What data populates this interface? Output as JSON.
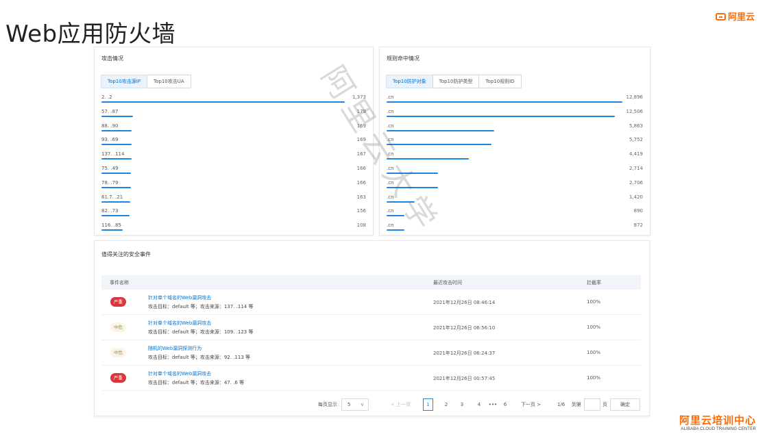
{
  "slide": {
    "title": "Web应用防火墙"
  },
  "brand": {
    "logo_text": "阿里云",
    "training_cn": "阿里云培训中心",
    "training_en": "ALIBABA CLOUD TRAINING CENTER"
  },
  "watermark": {
    "text": "阿里云大学"
  },
  "attack_panel": {
    "title": "攻击情况",
    "tabs": [
      {
        "label": "Top10攻击源IP",
        "active": true
      },
      {
        "label": "Top10攻击UA",
        "active": false
      }
    ],
    "rows": [
      {
        "label": "2.  .2",
        "value": "1,373",
        "pct": 0.92
      },
      {
        "label": "57.    .87",
        "value": "179",
        "pct": 0.12
      },
      {
        "label": "88.    .90",
        "value": "169",
        "pct": 0.115
      },
      {
        "label": "93.    .69",
        "value": "169",
        "pct": 0.115
      },
      {
        "label": "137.      .114",
        "value": "167",
        "pct": 0.113
      },
      {
        "label": "75.    .49",
        "value": "166",
        "pct": 0.112
      },
      {
        "label": "78.    .79",
        "value": "166",
        "pct": 0.112
      },
      {
        "label": "61.7.  .21",
        "value": "163",
        "pct": 0.11
      },
      {
        "label": "82.    .73",
        "value": "156",
        "pct": 0.106
      },
      {
        "label": "116.    .85",
        "value": "108",
        "pct": 0.08
      }
    ]
  },
  "rule_panel": {
    "title": "规则命中情况",
    "tabs": [
      {
        "label": "Top10防护对象",
        "active": true
      },
      {
        "label": "Top10防护类型",
        "active": false
      },
      {
        "label": "Top10规则ID",
        "active": false
      }
    ],
    "rows": [
      {
        "label": ".cn",
        "value": "12,896",
        "pct": 0.92
      },
      {
        "label": ".cn",
        "value": "12,506",
        "pct": 0.89
      },
      {
        "label": ".cn",
        "value": "5,863",
        "pct": 0.42
      },
      {
        "label": ".cn",
        "value": "5,752",
        "pct": 0.41
      },
      {
        "label": ".cn",
        "value": "4,419",
        "pct": 0.32
      },
      {
        "label": ".cn",
        "value": "2,714",
        "pct": 0.2
      },
      {
        "label": ".cn",
        "value": "2,706",
        "pct": 0.2
      },
      {
        "label": ".cn",
        "value": "1,420",
        "pct": 0.11
      },
      {
        "label": ".cn",
        "value": "890",
        "pct": 0.07
      },
      {
        "label": ".cn",
        "value": "872",
        "pct": 0.07
      }
    ]
  },
  "events_panel": {
    "title": "值得关注的安全事件",
    "columns": {
      "name": "事件名称",
      "time": "最近攻击时间",
      "rate": "拦截率"
    },
    "rows": [
      {
        "severity": "严重",
        "level": "high",
        "name": "针对单个域名的Web漏洞攻击",
        "desc": "攻击目标：default 等；攻击来源：137.        .114 等",
        "time": "2021年12月26日 08:46:14",
        "rate": "100%"
      },
      {
        "severity": "中危",
        "level": "mid",
        "name": "针对单个域名的Web漏洞攻击",
        "desc": "攻击目标：default 等；攻击来源：109.        .123 等",
        "time": "2021年12月26日 06:56:10",
        "rate": "100%"
      },
      {
        "severity": "中危",
        "level": "mid",
        "name": "随机的Web漏洞探测行为",
        "desc": "攻击目标：default 等；攻击来源：92.        .113 等",
        "time": "2021年12月26日 06:24:37",
        "rate": "100%"
      },
      {
        "severity": "严重",
        "level": "high",
        "name": "针对单个域名的Web漏洞攻击",
        "desc": "攻击目标：default 等；攻击来源：47.        .6 等",
        "time": "2021年12月26日 00:57:45",
        "rate": "100%"
      }
    ],
    "pagination": {
      "page_size_label": "每页显示",
      "page_size": "5",
      "prev": "< 上一页",
      "pages": [
        "1",
        "2",
        "3",
        "4"
      ],
      "ellipsis": "•••",
      "last_page": "6",
      "next": "下一页 >",
      "current": "1/6",
      "goto_label": "到第",
      "goto_value": "",
      "page_unit": "页",
      "confirm": "确定"
    }
  }
}
